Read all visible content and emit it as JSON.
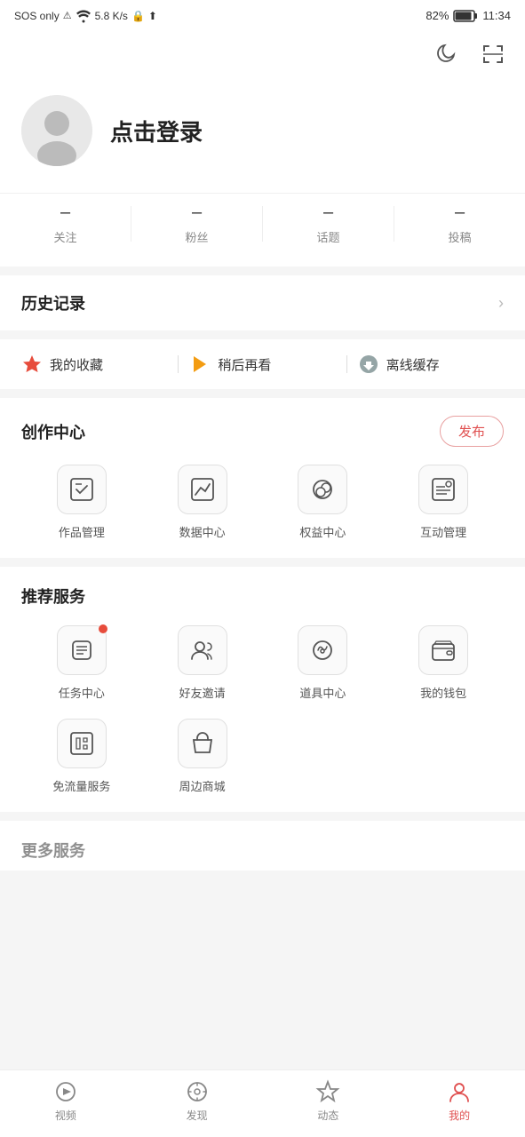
{
  "statusBar": {
    "left": "SOS only",
    "signal": "5.8 K/s",
    "battery": "82%",
    "time": "11:34"
  },
  "header": {
    "moonIcon": "moon-icon",
    "scanIcon": "scan-icon"
  },
  "profile": {
    "loginText": "点击登录",
    "avatarAlt": "avatar"
  },
  "stats": [
    {
      "value": "–",
      "label": "关注"
    },
    {
      "value": "–",
      "label": "粉丝"
    },
    {
      "value": "–",
      "label": "话题"
    },
    {
      "value": "–",
      "label": "投稿"
    }
  ],
  "history": {
    "title": "历史记录"
  },
  "quickLinks": [
    {
      "icon": "star-icon",
      "label": "我的收藏",
      "color": "#e74c3c"
    },
    {
      "icon": "play-later-icon",
      "label": "稍后再看",
      "color": "#f39c12"
    },
    {
      "icon": "offline-icon",
      "label": "离线缓存",
      "color": "#95a5a6"
    }
  ],
  "creation": {
    "title": "创作中心",
    "publishLabel": "发布",
    "items": [
      {
        "icon": "works-icon",
        "label": "作品管理"
      },
      {
        "icon": "data-icon",
        "label": "数据中心"
      },
      {
        "icon": "rights-icon",
        "label": "权益中心"
      },
      {
        "icon": "interaction-icon",
        "label": "互动管理"
      }
    ]
  },
  "services": {
    "title": "推荐服务",
    "items": [
      {
        "icon": "task-icon",
        "label": "任务中心",
        "badge": true
      },
      {
        "icon": "friends-icon",
        "label": "好友邀请",
        "badge": false
      },
      {
        "icon": "props-icon",
        "label": "道具中心",
        "badge": false
      },
      {
        "icon": "wallet-icon",
        "label": "我的钱包",
        "badge": false
      },
      {
        "icon": "free-traffic-icon",
        "label": "免流量服务",
        "badge": false
      },
      {
        "icon": "merch-icon",
        "label": "周边商城",
        "badge": false
      }
    ]
  },
  "bottomFade": {
    "title": "更多服务"
  },
  "bottomNav": [
    {
      "icon": "video-icon",
      "label": "视频",
      "active": false
    },
    {
      "icon": "discover-icon",
      "label": "发现",
      "active": false
    },
    {
      "icon": "activity-icon",
      "label": "动态",
      "active": false
    },
    {
      "icon": "profile-icon",
      "label": "我的",
      "active": true
    }
  ]
}
